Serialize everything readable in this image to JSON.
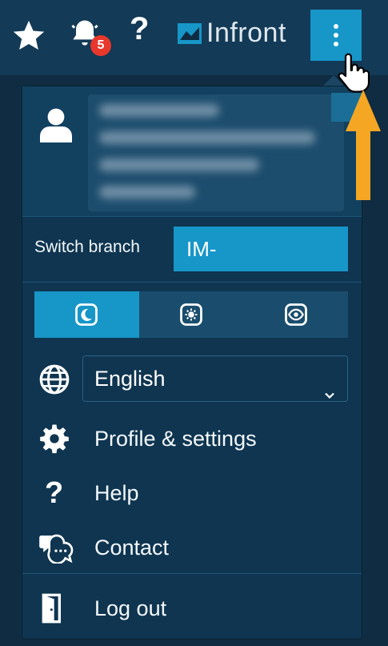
{
  "topbar": {
    "notification_count": "5",
    "help_glyph": "?",
    "logo_text": "Infront",
    "icons": [
      "star-icon",
      "bell-icon",
      "help-icon",
      "infront-logo-icon",
      "more-vertical-icon"
    ]
  },
  "menu": {
    "switch_branch_label": "Switch branch",
    "branch_value": "IM-",
    "theme_options": [
      "dark-mode-icon",
      "light-mode-icon",
      "contrast-mode-icon"
    ],
    "active_theme": "dark-mode-icon",
    "language": {
      "selected": "English"
    },
    "items": [
      {
        "label": "Profile & settings",
        "icon": "gear-icon"
      },
      {
        "label": "Help",
        "icon": "help-icon"
      },
      {
        "label": "Contact",
        "icon": "chat-icon"
      }
    ],
    "logout_label": "Log out"
  },
  "colors": {
    "accent": "#1796c8",
    "background": "#0f2c42",
    "panel": "#0f3550",
    "badge": "#e8372c",
    "annotation_arrow": "#f5a623"
  }
}
